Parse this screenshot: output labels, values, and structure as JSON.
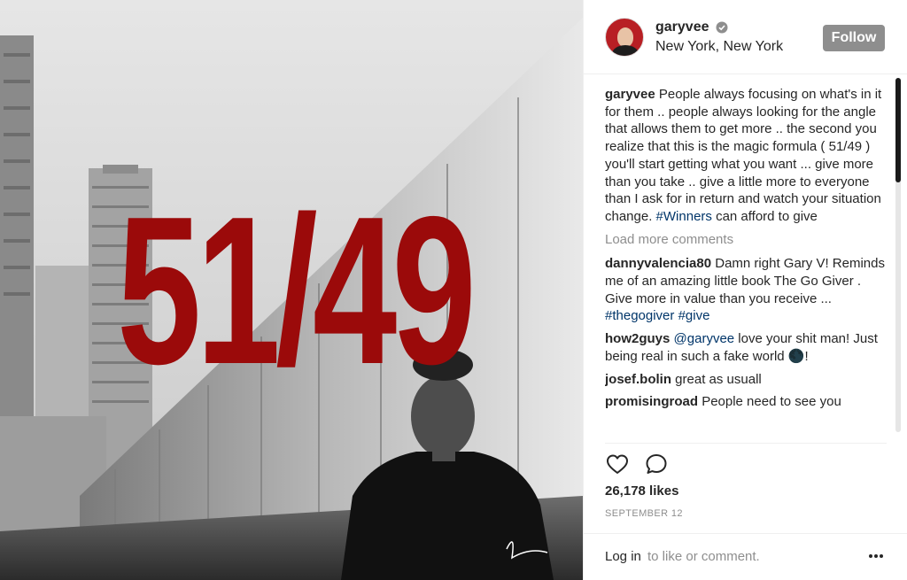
{
  "post": {
    "overlay_text": "51/49"
  },
  "header": {
    "username": "garyvee",
    "location": "New York, New York",
    "follow_label": "Follow",
    "verified_icon": "verified-badge-icon"
  },
  "comments": {
    "caption": {
      "user": "garyvee",
      "text": "People always focusing on what's in it for them .. people always looking for the angle that allows them to get more .. the second you realize that this is the magic formula ( 51/49 ) you'll start getting what you want ... give more than you take .. give a little more to everyone than I ask for in return and watch your situation change. ",
      "hashtag": "#Winners",
      "text_after": " can afford to give"
    },
    "load_more_label": "Load more comments",
    "items": [
      {
        "user": "dannyvalencia80",
        "text": "Damn right Gary V! Reminds me of an amazing little book The Go Giver . Give more in value than you receive ... ",
        "hashtag1": "#thegogiver",
        "hashtag2": "#give"
      },
      {
        "user": "how2guys",
        "mention": "@garyvee",
        "text": " love your shit man! Just being real in such a fake world 🌑!"
      },
      {
        "user": "josef.bolin",
        "text": "great as usuall"
      },
      {
        "user": "promisingroad",
        "text": "People need to see you"
      }
    ]
  },
  "actions": {
    "like_icon": "heart-icon",
    "comment_icon": "comment-bubble-icon"
  },
  "likes": "26,178 likes",
  "date": "SEPTEMBER 12",
  "footer": {
    "login_label": "Log in",
    "login_rest": "to like or comment.",
    "more_icon": "more-options-icon"
  },
  "colors": {
    "overlay_red": "#9b0a0a",
    "follow_bg": "#8e8e8e",
    "hashtag": "#003569",
    "muted": "#8e8e8e"
  }
}
